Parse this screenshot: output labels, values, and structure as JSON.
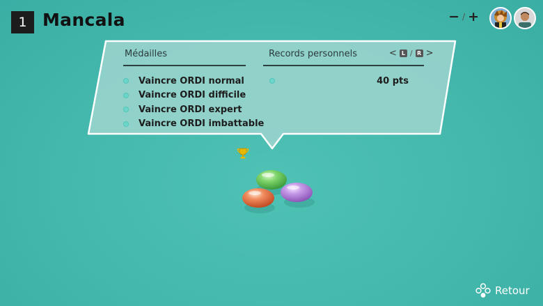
{
  "header": {
    "game_number": "1",
    "title": "Mancala"
  },
  "players": {
    "minus_label": "−",
    "separator": "/",
    "plus_label": "+"
  },
  "panel": {
    "medals_header": "Médailles",
    "records_header": "Records personnels",
    "nav": {
      "prev": "<",
      "key_l": "L",
      "separator": "/",
      "key_r": "R",
      "next": ">"
    },
    "medals": [
      {
        "label": "Vaincre ORDI normal"
      },
      {
        "label": "Vaincre ORDI difficile"
      },
      {
        "label": "Vaincre ORDI expert"
      },
      {
        "label": "Vaincre ORDI imbattable"
      }
    ],
    "record": {
      "value": "40 pts"
    }
  },
  "footer": {
    "back_label": "Retour"
  },
  "colors": {
    "background": "#44b8ac",
    "panel_fill": "#9dd5cf",
    "medal_dot": "#6dd6cb",
    "stone_green": "#5fc45a",
    "stone_red": "#e8683e",
    "stone_purple": "#b57ed8",
    "trophy": "#e6b800"
  }
}
